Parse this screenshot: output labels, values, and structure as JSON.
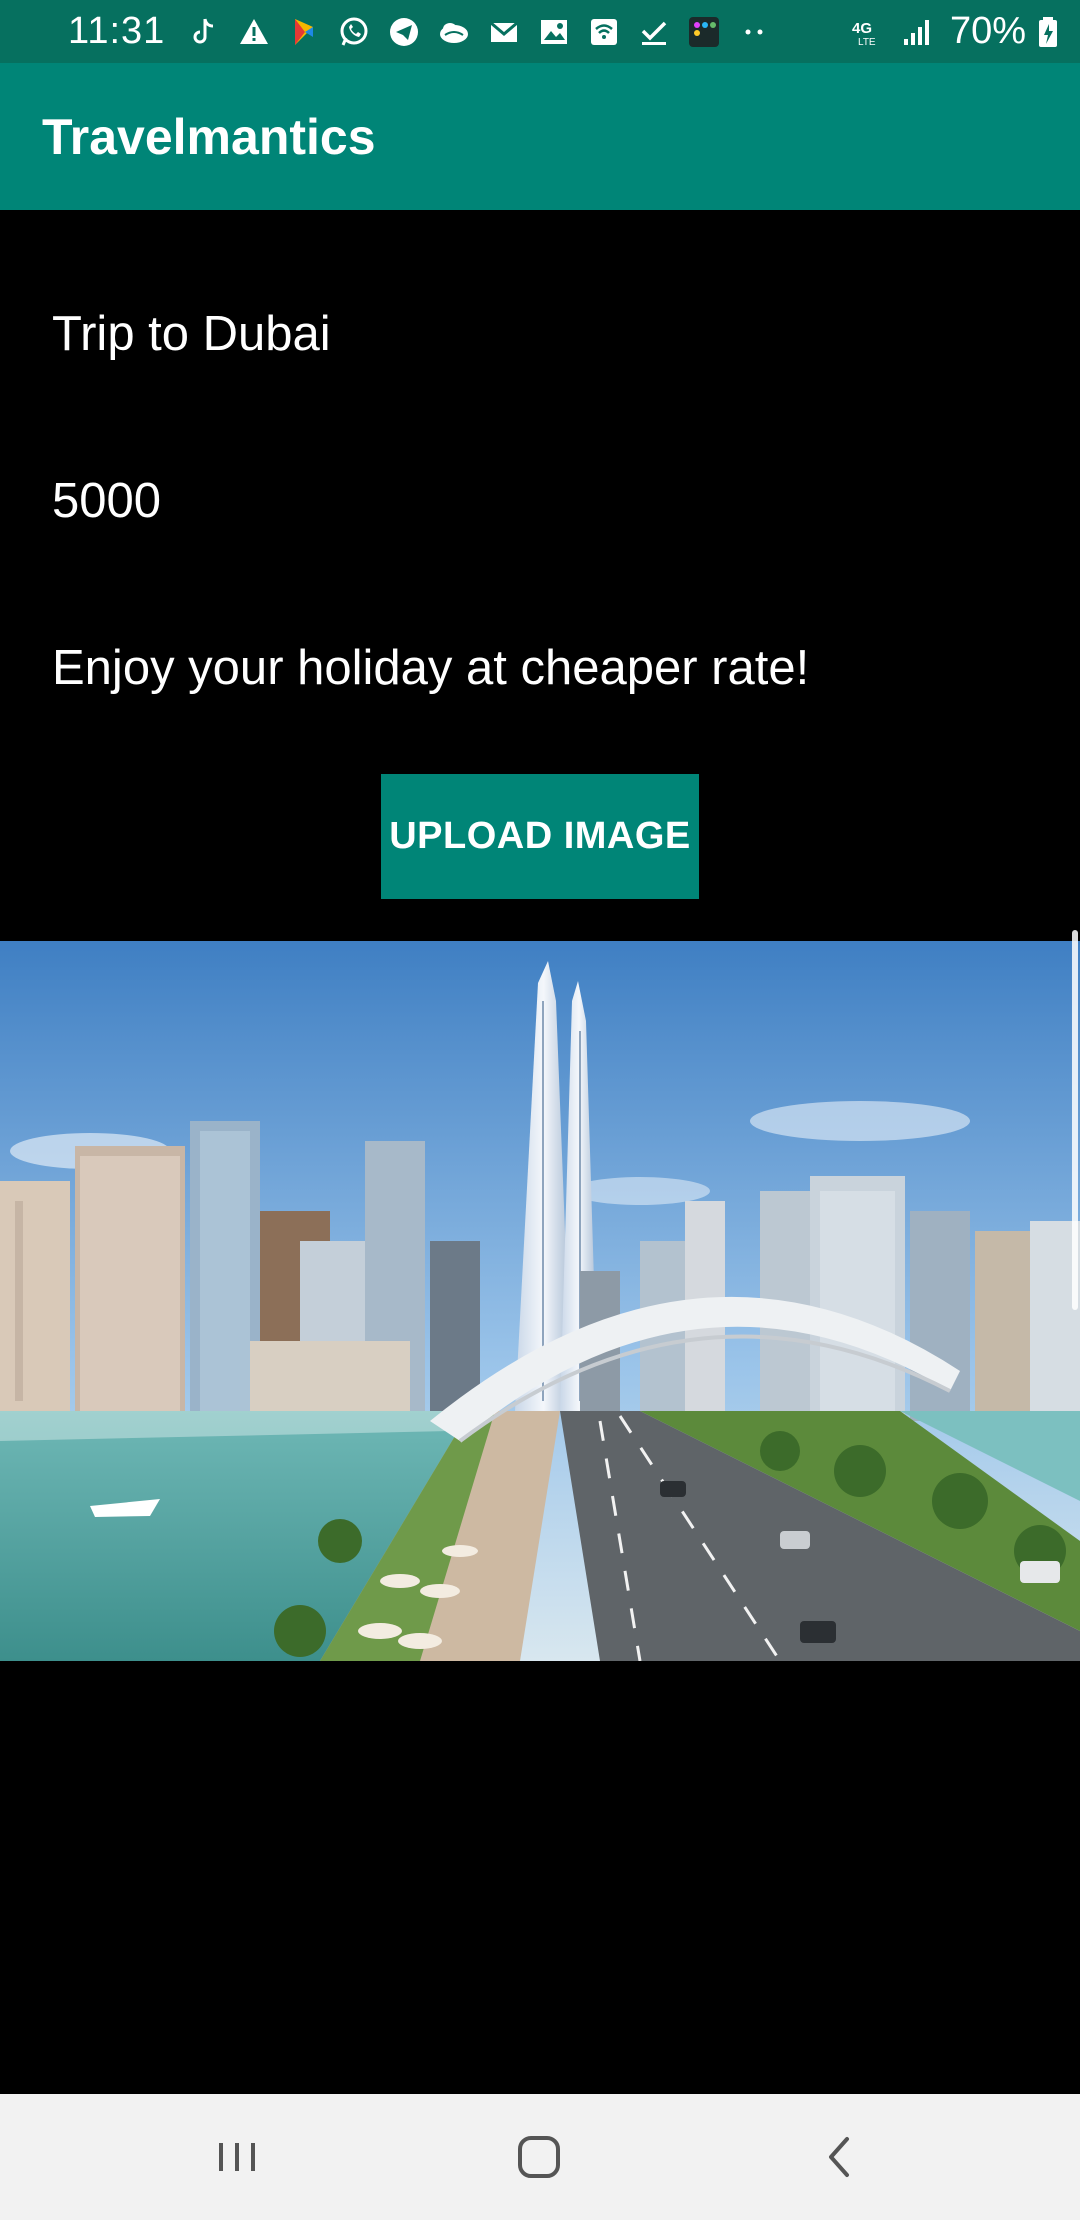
{
  "status_bar": {
    "time": "11:31",
    "battery": "70%",
    "network": "4G LTE",
    "icons": [
      "tiktok-icon",
      "warning-icon",
      "app-icon",
      "whatsapp-icon",
      "telegram-icon",
      "cloud-icon",
      "gmail-icon",
      "gallery-icon",
      "wifi-call-icon",
      "check-icon",
      "app-badge-icon",
      "more-dots-icon"
    ]
  },
  "app_bar": {
    "title": "Travelmantics",
    "color": "#008577"
  },
  "deal": {
    "title": "Trip to Dubai",
    "price": "5000",
    "description": "Enjoy your holiday at cheaper rate!"
  },
  "upload_button": {
    "label": "UPLOAD IMAGE"
  },
  "image": {
    "subject": "Dubai skyline with twin towers, bridge and waterfront"
  },
  "nav_bar": {
    "icons": [
      "recents-icon",
      "home-icon",
      "back-icon"
    ]
  }
}
